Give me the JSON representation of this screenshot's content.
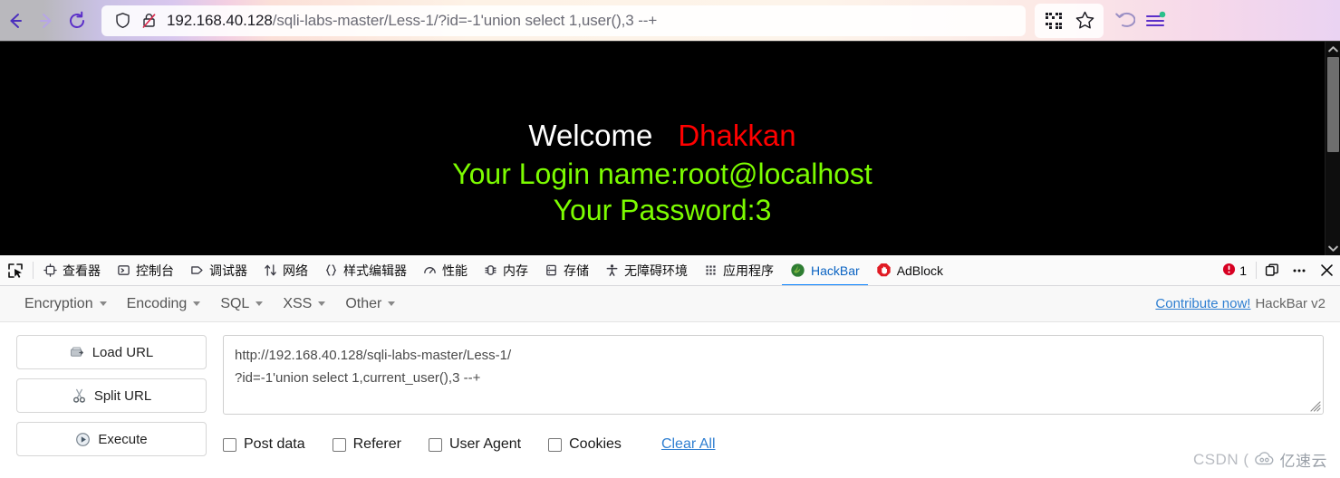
{
  "browser": {
    "nav": {
      "back_icon": "arrow-left-icon",
      "forward_icon": "arrow-right-icon",
      "reload_icon": "reload-icon"
    },
    "urlbar": {
      "shield_icon": "shield-icon",
      "lock_icon": "lock-crossed-icon",
      "host": "192.168.40.128",
      "path": "/sqli-labs-master/Less-1/?id=-1'union select 1,user(),3 --+",
      "full_url": "192.168.40.128/sqli-labs-master/Less-1/?id=-1'union select 1,user(),3 --+"
    },
    "right_actions": [
      {
        "name": "qr-code-icon",
        "label": ""
      },
      {
        "name": "bookmark-star-icon",
        "label": ""
      },
      {
        "name": "undo-arrow-icon",
        "label": ""
      },
      {
        "name": "app-menu-icon",
        "label": ""
      }
    ]
  },
  "page": {
    "welcome_label": "Welcome",
    "welcome_name": "Dhakkan",
    "login_line": "Your Login name:root@localhost",
    "password_line": "Your Password:3",
    "colors": {
      "background": "#000000",
      "welcome": "#ffffff",
      "name": "#ff0000",
      "result": "#7cfc00"
    }
  },
  "devtools": {
    "picker_icon": "element-picker-icon",
    "tabs": [
      {
        "label": "查看器",
        "icon": "inspector-icon",
        "selected": false
      },
      {
        "label": "控制台",
        "icon": "console-icon",
        "selected": false
      },
      {
        "label": "调试器",
        "icon": "debugger-icon",
        "selected": false
      },
      {
        "label": "网络",
        "icon": "network-icon",
        "selected": false
      },
      {
        "label": "样式编辑器",
        "icon": "style-editor-icon",
        "selected": false
      },
      {
        "label": "性能",
        "icon": "performance-icon",
        "selected": false
      },
      {
        "label": "内存",
        "icon": "memory-icon",
        "selected": false
      },
      {
        "label": "存储",
        "icon": "storage-icon",
        "selected": false
      },
      {
        "label": "无障碍环境",
        "icon": "accessibility-icon",
        "selected": false
      },
      {
        "label": "应用程序",
        "icon": "application-icon",
        "selected": false
      },
      {
        "label": "HackBar",
        "icon": "hackbar-icon",
        "selected": true
      },
      {
        "label": "AdBlock",
        "icon": "adblock-icon",
        "selected": false
      }
    ],
    "error_count": "1",
    "error_icon": "error-badge-icon",
    "dock_icon": "dock-panel-icon",
    "more_icon": "more-options-icon",
    "close_icon": "close-icon",
    "active_tab_color": "#0a84ff"
  },
  "hackbar": {
    "menus": [
      {
        "label": "Encryption"
      },
      {
        "label": "Encoding"
      },
      {
        "label": "SQL"
      },
      {
        "label": "XSS"
      },
      {
        "label": "Other"
      }
    ],
    "contribute_label": "Contribute now!",
    "version_label": "HackBar v2",
    "buttons": [
      {
        "label": "Load URL",
        "icon": "load-url-icon"
      },
      {
        "label": "Split URL",
        "icon": "split-url-icon"
      },
      {
        "label": "Execute",
        "icon": "execute-icon"
      }
    ],
    "url_textarea": {
      "line1": "http://192.168.40.128/sqli-labs-master/Less-1/",
      "line2": "?id=-1'union select 1,current_user(),3 --+"
    },
    "checkboxes": [
      {
        "label": "Post data",
        "checked": false
      },
      {
        "label": "Referer",
        "checked": false
      },
      {
        "label": "User Agent",
        "checked": false
      },
      {
        "label": "Cookies",
        "checked": false
      }
    ],
    "clear_all_label": "Clear All",
    "link_color": "#2f7fd1"
  },
  "watermark": {
    "text": "CSDN (",
    "brand": "亿速云",
    "logo_icon": "cloud-logo-icon"
  }
}
